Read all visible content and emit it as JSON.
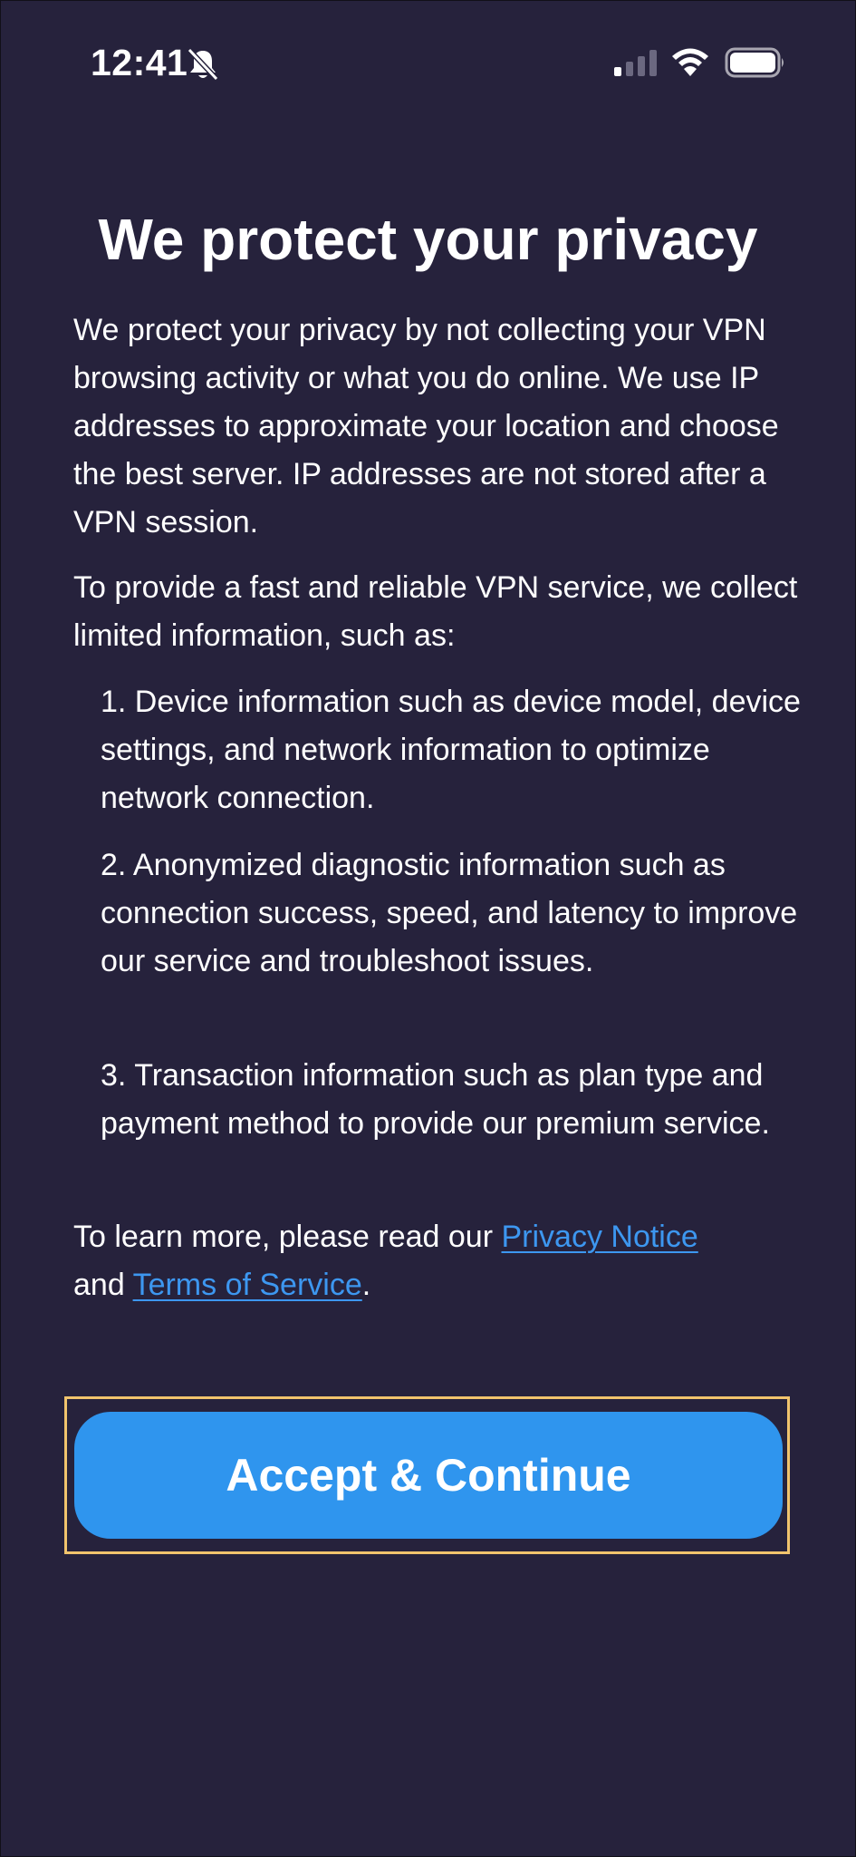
{
  "status_bar": {
    "time": "12:41",
    "icons": [
      "bell-slash-icon",
      "cellular-signal-icon",
      "wifi-icon",
      "battery-icon"
    ]
  },
  "title": "We protect your privacy",
  "paragraphs": {
    "p1": "We protect your privacy by not collecting your VPN browsing activity or what you do online. We use IP addresses to approximate your location and choose the best server. IP addresses are not stored after a VPN session.",
    "p2": "To provide a fast and reliable VPN service, we collect limited information, such as:"
  },
  "list": [
    "1. Device information such as device model, device settings, and network information to optimize network connection.",
    "2. Anonymized diagnostic information such as connection success, speed, and latency to improve our service and troubleshoot issues.",
    "3. Transaction information such as plan type and payment method to provide our premium service."
  ],
  "learn_more": {
    "prefix": "To learn more, please read our ",
    "privacy_link": "Privacy Notice",
    "middle": "and ",
    "terms_link": "Terms of Service",
    "suffix": "."
  },
  "accept_button": {
    "label": "Accept & Continue"
  },
  "colors": {
    "background": "#26223c",
    "link": "#3d97f0",
    "button": "#2f95ee",
    "focus_ring": "#f1c46d"
  }
}
